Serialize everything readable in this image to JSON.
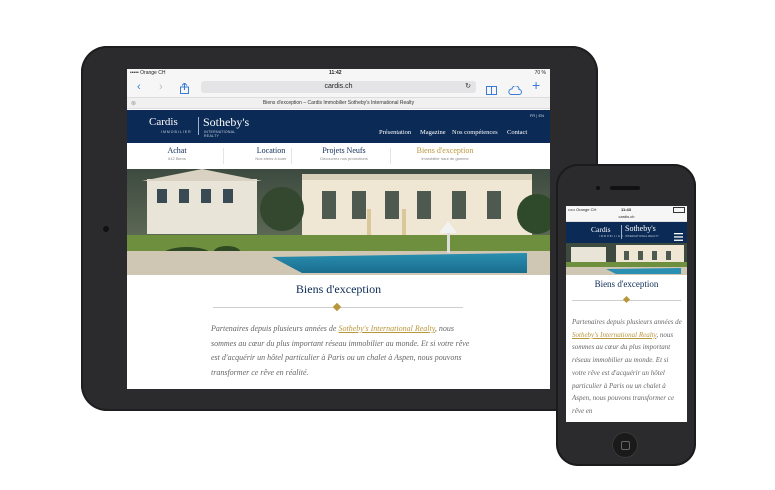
{
  "tablet": {
    "status": {
      "carrier": "••••• Orange CH",
      "time": "11:42",
      "battery": "70 %"
    },
    "url": "cardis.ch",
    "tab_title": "Biens d'exception – Cardis Immobilier Sotheby's International Realty",
    "logo": {
      "cardis": "Cardis",
      "cardis_sub": "IMMOBILIER",
      "sothebys": "Sotheby's",
      "sothebys_sub": "INTERNATIONAL REALTY"
    },
    "lang": "FR | EN",
    "nav": [
      "Présentation",
      "Magazine",
      "Nos compétences",
      "Contact"
    ],
    "menu": [
      {
        "title": "Achat",
        "subtitle": "612 Biens"
      },
      {
        "title": "Location",
        "subtitle": "Nos biens à louer"
      },
      {
        "title": "Projets Neufs",
        "subtitle": "Découvrez nos promotions"
      },
      {
        "title": "Biens d'exception",
        "subtitle": "Immobilier haut de gamme"
      }
    ],
    "heading": "Biens d'exception",
    "body_pre": "Partenaires depuis plusieurs années de ",
    "body_link": "Sotheby's International Realty",
    "body_post": ", nous sommes au cœur du plus important réseau immobilier au monde. Et si votre rêve est d'acquérir un hôtel particulier à Paris ou un chalet à Aspen, nous pouvons transformer ce rêve en réalité."
  },
  "phone": {
    "status": {
      "carrier": "••••• Orange CH",
      "time": "11:43"
    },
    "url": "cardis.ch",
    "logo": {
      "cardis": "Cardis",
      "cardis_sub": "IMMOBILIER",
      "sothebys": "Sotheby's",
      "sothebys_sub": "INTERNATIONAL REALTY"
    },
    "heading": "Biens d'exception",
    "body_pre": "Partenaires depuis plusieurs années de ",
    "body_link": "Sotheby's International Realty",
    "body_post": ", nous sommes au cœur du plus important réseau immobilier au monde. Et si votre rêve est d'acquérir un hôtel particulier à Paris ou un chalet à Aspen, nous pouvons transformer ce rêve en"
  },
  "colors": {
    "navy": "#0b2a55",
    "gold": "#b8963c",
    "device": "#2b2b2d"
  }
}
